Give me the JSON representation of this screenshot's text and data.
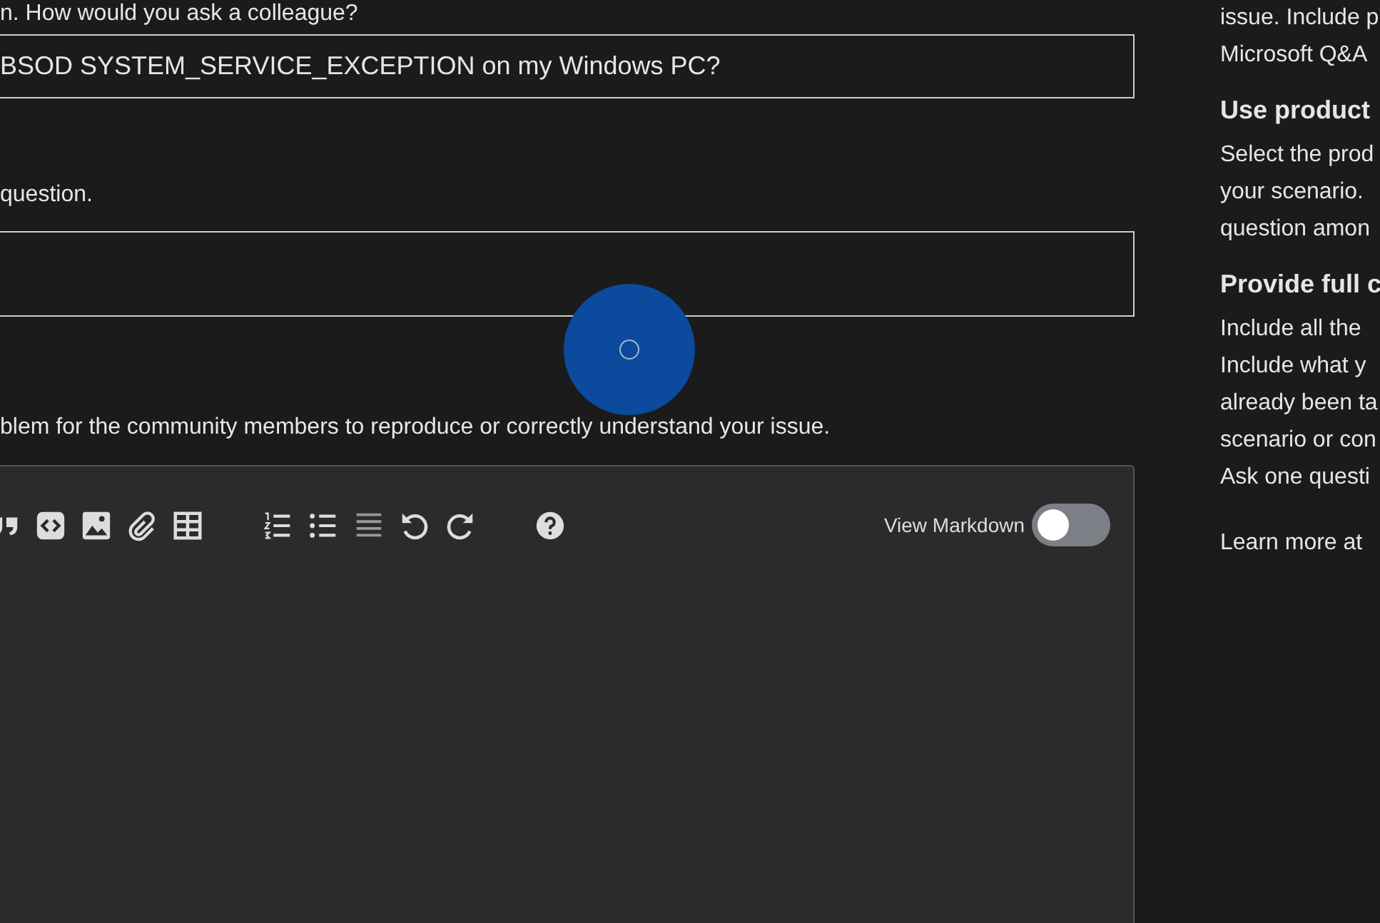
{
  "main": {
    "title_hint": "n. How would you ask a colleague?",
    "title_field": {
      "value": "BSOD SYSTEM_SERVICE_EXCEPTION on my Windows PC?"
    },
    "tags_hint": "question.",
    "body_hint": "blem for the community members to reproduce or correctly understand your issue.",
    "editor": {
      "tools": [
        {
          "kind": "quote"
        },
        {
          "kind": "code"
        },
        {
          "kind": "image"
        },
        {
          "kind": "attach"
        },
        {
          "kind": "table"
        },
        {
          "kind": "gap"
        },
        {
          "kind": "numbered"
        },
        {
          "kind": "bulleted"
        },
        {
          "kind": "rule"
        },
        {
          "kind": "undo"
        },
        {
          "kind": "redo"
        },
        {
          "kind": "gap"
        },
        {
          "kind": "help"
        }
      ],
      "toggle": {
        "label": "View Markdown",
        "on": false
      }
    }
  },
  "sidebar": {
    "lines_top": [
      "issue. Include p",
      "Microsoft Q&A"
    ],
    "sections": [
      {
        "heading": "Use product",
        "lines": [
          "Select the prod",
          "your scenario.",
          "question amon"
        ]
      },
      {
        "heading": "Provide full c",
        "lines": [
          "Include all the",
          "Include what y",
          "already been ta",
          "scenario or con",
          "Ask one questi"
        ]
      }
    ],
    "footer": "Learn more at"
  }
}
